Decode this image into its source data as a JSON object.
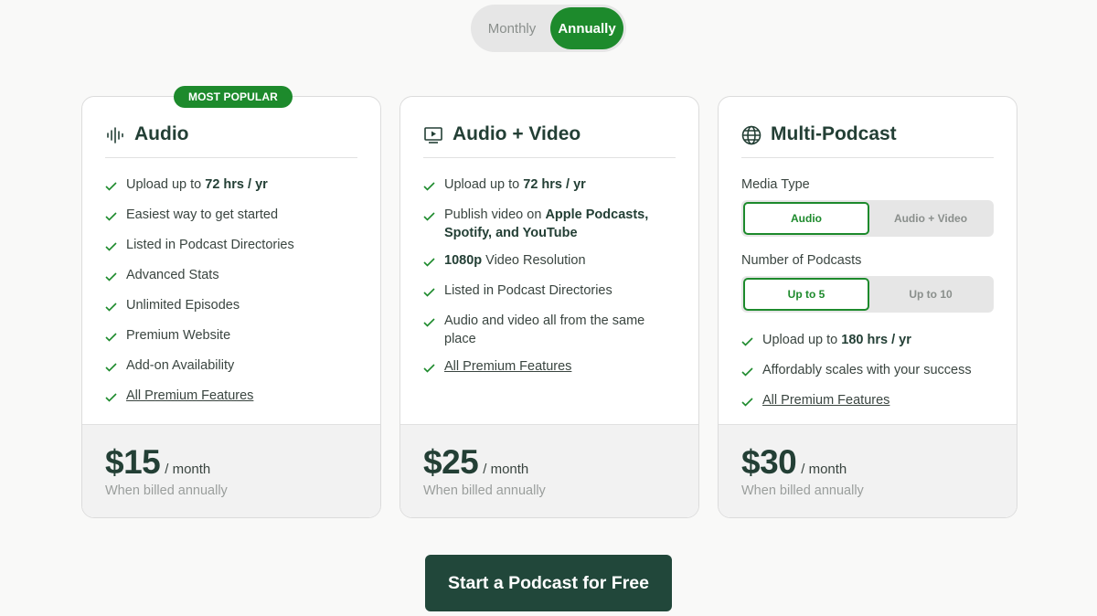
{
  "billing_toggle": {
    "monthly_label": "Monthly",
    "annually_label": "Annually",
    "selected": "Annually"
  },
  "colors": {
    "accent": "#1d8a2c",
    "dark": "#21473a",
    "heading": "#233f35"
  },
  "plans": [
    {
      "badge": "MOST POPULAR",
      "icon": "audio-waveform-icon",
      "title": "Audio",
      "features": [
        {
          "pre": "Upload up to ",
          "bold": "72 hrs / yr",
          "post": ""
        },
        {
          "pre": "Easiest way to get started",
          "bold": "",
          "post": ""
        },
        {
          "pre": "Listed in Podcast Directories",
          "bold": "",
          "post": ""
        },
        {
          "pre": "Advanced Stats",
          "bold": "",
          "post": ""
        },
        {
          "pre": "Unlimited Episodes",
          "bold": "",
          "post": ""
        },
        {
          "pre": "Premium Website",
          "bold": "",
          "post": ""
        },
        {
          "pre": "Add-on Availability",
          "bold": "",
          "post": ""
        }
      ],
      "link": "All Premium Features",
      "price": "$15",
      "per": "/ month",
      "billed": "When billed annually"
    },
    {
      "icon": "video-play-icon",
      "title": "Audio + Video",
      "features": [
        {
          "pre": "Upload up to ",
          "bold": "72 hrs / yr",
          "post": ""
        },
        {
          "pre": "Publish video on ",
          "bold": "Apple Podcasts, Spotify, and YouTube",
          "post": ""
        },
        {
          "pre": "",
          "bold": "1080p",
          "post": " Video Resolution"
        },
        {
          "pre": "Listed in Podcast Directories",
          "bold": "",
          "post": ""
        },
        {
          "pre": "Audio and video all from the same place",
          "bold": "",
          "post": ""
        }
      ],
      "link": "All Premium Features",
      "price": "$25",
      "per": "/ month",
      "billed": "When billed annually"
    },
    {
      "icon": "globe-icon",
      "title": "Multi-Podcast",
      "media_type_label": "Media Type",
      "media_options": [
        "Audio",
        "Audio + Video"
      ],
      "media_selected": "Audio",
      "count_label": "Number of Podcasts",
      "count_options": [
        "Up to 5",
        "Up to 10"
      ],
      "count_selected": "Up to 5",
      "features": [
        {
          "pre": "Upload up to ",
          "bold": "180 hrs / yr",
          "post": ""
        },
        {
          "pre": "Affordably scales with your success",
          "bold": "",
          "post": ""
        }
      ],
      "link": "All Premium Features",
      "price": "$30",
      "per": "/ month",
      "billed": "When billed annually"
    }
  ],
  "cta": {
    "label": "Start a Podcast for Free"
  }
}
